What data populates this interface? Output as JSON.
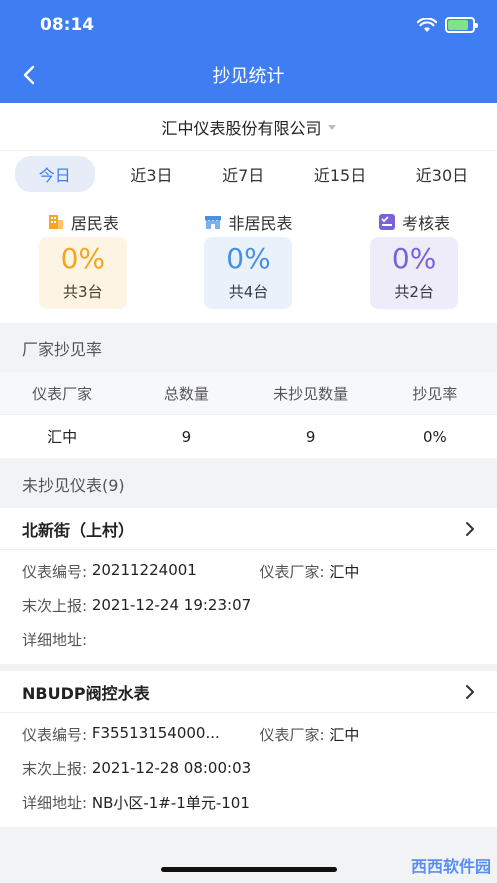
{
  "status": {
    "time": "08:14"
  },
  "nav": {
    "title": "抄见统计"
  },
  "company": {
    "name": "汇中仪表股份有限公司"
  },
  "tabs": [
    {
      "label": "今日",
      "active": true
    },
    {
      "label": "近3日"
    },
    {
      "label": "近7日"
    },
    {
      "label": "近15日"
    },
    {
      "label": "近30日"
    }
  ],
  "summary": [
    {
      "title": "居民表",
      "percent": "0%",
      "count": "共3台",
      "color": "#f5a623",
      "icon": "building-icon"
    },
    {
      "title": "非居民表",
      "percent": "0%",
      "count": "共4台",
      "color": "#4a90e2",
      "icon": "store-icon"
    },
    {
      "title": "考核表",
      "percent": "0%",
      "count": "共2台",
      "color": "#7b61d9",
      "icon": "checklist-icon"
    }
  ],
  "rate_section": {
    "title": "厂家抄见率",
    "columns": [
      "仪表厂家",
      "总数量",
      "未抄见数量",
      "抄见率"
    ],
    "rows": [
      [
        "汇中",
        "9",
        "9",
        "0%"
      ]
    ]
  },
  "unread_section": {
    "title": "未抄见仪表(9)"
  },
  "meters": [
    {
      "name": "北新街（上村）",
      "no_label": "仪表编号:",
      "no": "20211224001",
      "vendor_label": "仪表厂家:",
      "vendor": "汇中",
      "last_label": "末次上报:",
      "last": "2021-12-24 19:23:07",
      "addr_label": "详细地址:",
      "addr": ""
    },
    {
      "name": "NBUDP阀控水表",
      "no_label": "仪表编号:",
      "no": "F35513154000...",
      "vendor_label": "仪表厂家:",
      "vendor": "汇中",
      "last_label": "末次上报:",
      "last": "2021-12-28 08:00:03",
      "addr_label": "详细地址:",
      "addr": "NB小区-1#-1单元-101"
    }
  ],
  "watermark": "西西软件园"
}
